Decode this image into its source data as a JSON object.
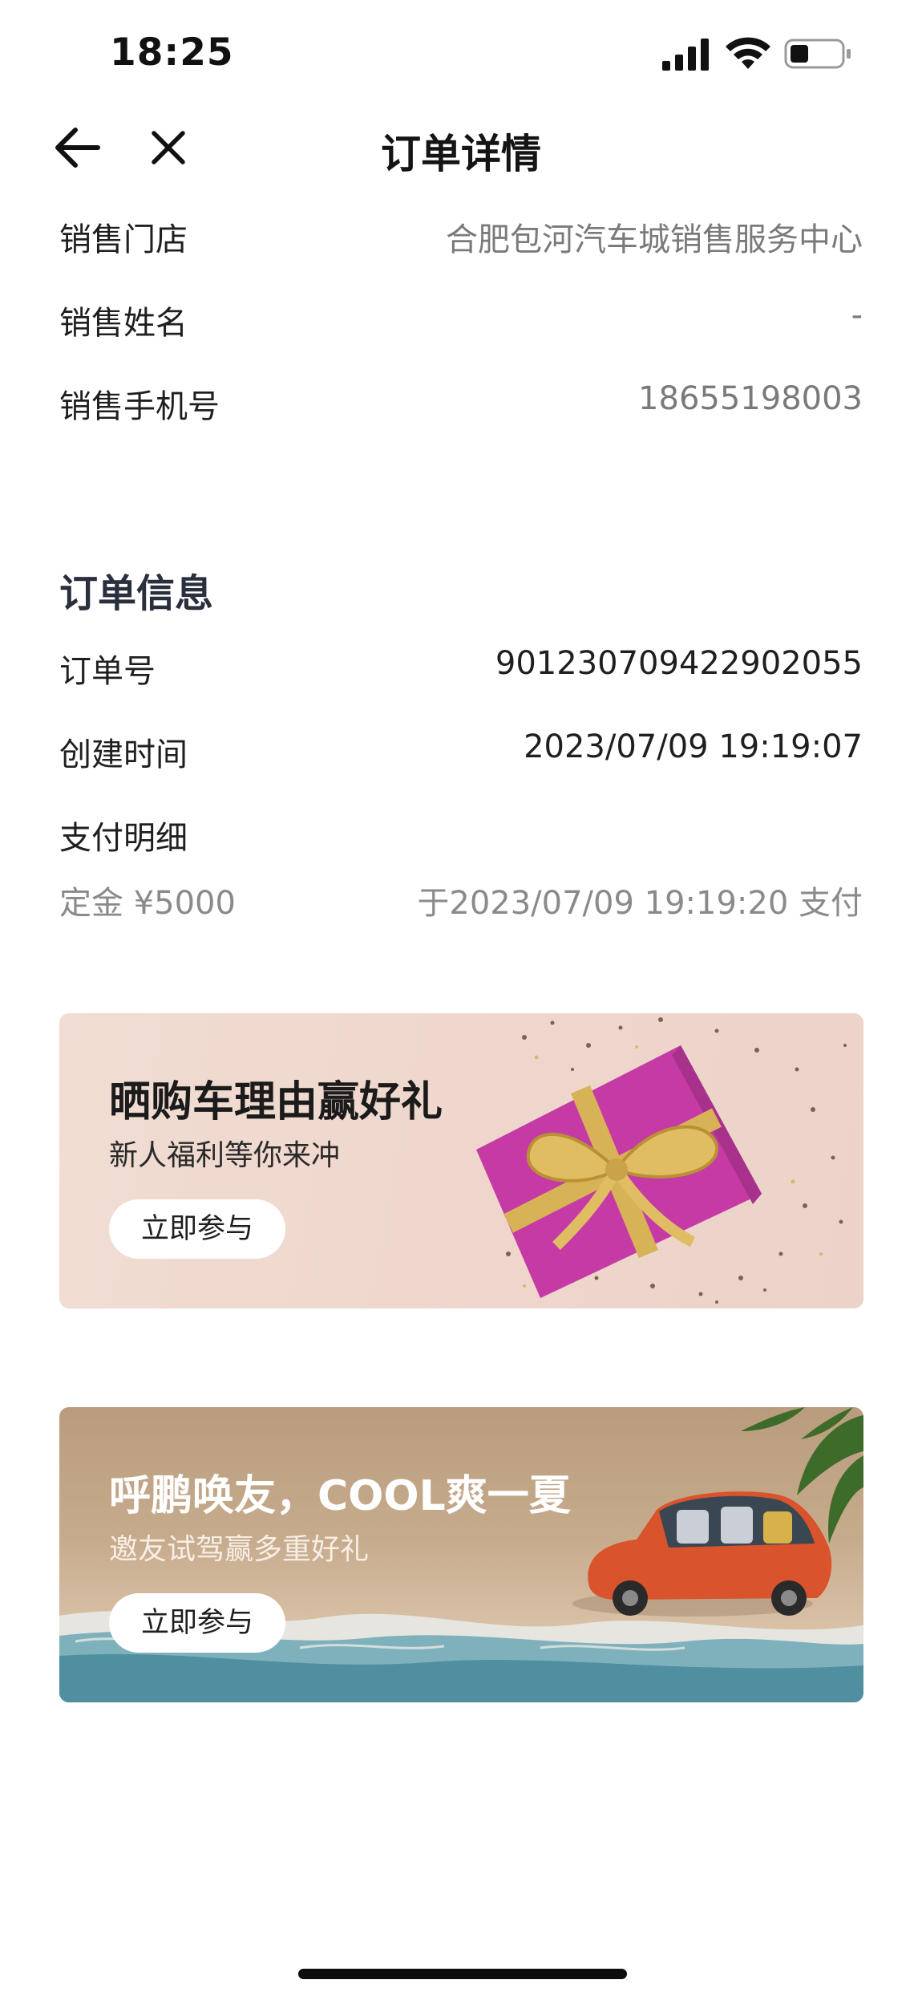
{
  "status_bar": {
    "time": "18:25"
  },
  "nav": {
    "title": "订单详情"
  },
  "sales": {
    "rows": [
      {
        "label": "销售门店",
        "value": "合肥包河汽车城销售服务中心"
      },
      {
        "label": "销售姓名",
        "value": "-"
      },
      {
        "label": "销售手机号",
        "value": "18655198003"
      }
    ]
  },
  "order": {
    "section_title": "订单信息",
    "rows": [
      {
        "label": "订单号",
        "value": "901230709422902055"
      },
      {
        "label": "创建时间",
        "value": "2023/07/09 19:19:07"
      }
    ],
    "payment_label": "支付明细",
    "payment_item": "定金 ¥5000",
    "payment_time": "于2023/07/09 19:19:20 支付"
  },
  "banners": [
    {
      "title": "晒购车理由赢好礼",
      "subtitle": "新人福利等你来冲",
      "button": "立即参与"
    },
    {
      "title": "呼鹏唤友，COOL爽一夏",
      "subtitle": "邀友试驾赢多重好礼",
      "button": "立即参与"
    }
  ],
  "colors": {
    "accent_gift": "#c93aa8",
    "car_orange": "#d9532c"
  }
}
